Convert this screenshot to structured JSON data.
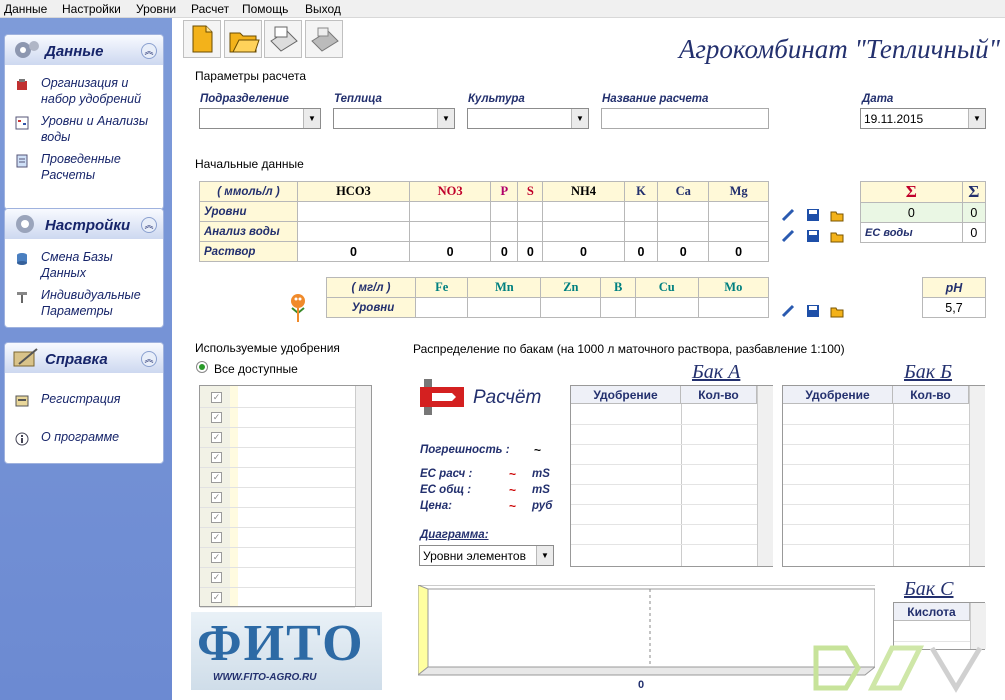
{
  "menu": [
    "Данные",
    "Настройки",
    "Уровни",
    "Расчет",
    "Помощь",
    "Выход"
  ],
  "sidebar": {
    "data_panel": {
      "title": "Данные",
      "items": [
        "Организация и набор удобрений",
        "Уровни и Анализы воды",
        "Проведенные Расчеты"
      ]
    },
    "settings_panel": {
      "title": "Настройки",
      "items": [
        "Смена Базы Данных",
        "Индивидуальные Параметры"
      ]
    },
    "help_panel": {
      "title": "Справка",
      "items": [
        "Регистрация",
        "О программе"
      ]
    }
  },
  "app_title": "Агрокомбинат \"Тепличный\"",
  "params": {
    "section_label": "Параметры расчета",
    "subdivision": "Подразделение",
    "greenhouse": "Теплица",
    "culture": "Культура",
    "calc_name": "Название расчета",
    "date_label": "Дата",
    "date_value": "19.11.2015"
  },
  "initial": {
    "section_label": "Начальные данные",
    "unit_mmol": "( ммоль/л )",
    "headers": [
      "HCO3",
      "NO3",
      "P",
      "S",
      "NH4",
      "K",
      "Ca",
      "Mg"
    ],
    "rows": [
      "Уровни",
      "Анализ воды",
      "Раствор"
    ],
    "solution_values": [
      "0",
      "0",
      "0",
      "0",
      "0",
      "0",
      "0",
      "0"
    ],
    "unit_mgl": "( мг/л )",
    "micro_headers": [
      "Fe",
      "Mn",
      "Zn",
      "B",
      "Cu",
      "Mo"
    ],
    "micro_row": "Уровни"
  },
  "sums": {
    "h1": "Σ",
    "h2": "Σ",
    "v1": "0",
    "v2": "0",
    "ec_label": "EC воды",
    "ec_value": "0"
  },
  "ph": {
    "label": "pH",
    "value": "5,7"
  },
  "fertilizers": {
    "section_label": "Используемые удобрения",
    "radio_label": "Все доступные",
    "rows": 11
  },
  "distribution": {
    "section_label": "Распределение по бакам (на 1000 л маточного раствора, разбавление 1:100)",
    "calc_button": "Расчёт",
    "error_label": "Погрешность :",
    "error_value": "~",
    "ec_calc_label": "ЕС расч :",
    "ec_total_label": "ЕС общ :",
    "price_label": "Цена:",
    "tilde": "~",
    "unit_ms": "mS",
    "unit_rub": "руб",
    "diagram_label": "Диаграмма:",
    "diagram_value": "Уровни элементов"
  },
  "tanks": {
    "a": {
      "title": "Бак А",
      "col1": "Удобрение",
      "col2": "Кол-во"
    },
    "b": {
      "title": "Бак Б",
      "col1": "Удобрение",
      "col2": "Кол-во"
    },
    "c": {
      "title": "Бак С",
      "col1": "Кислота"
    }
  },
  "chart_axis_value": "0",
  "logo": {
    "text": "ФИТО",
    "url": "WWW.FITO-AGRO.RU"
  },
  "colors": {
    "accent": "#23306e",
    "sidebar": "#7290d4",
    "header_bg": "#fff9d8",
    "red": "#c0002a",
    "teal": "#008080"
  }
}
